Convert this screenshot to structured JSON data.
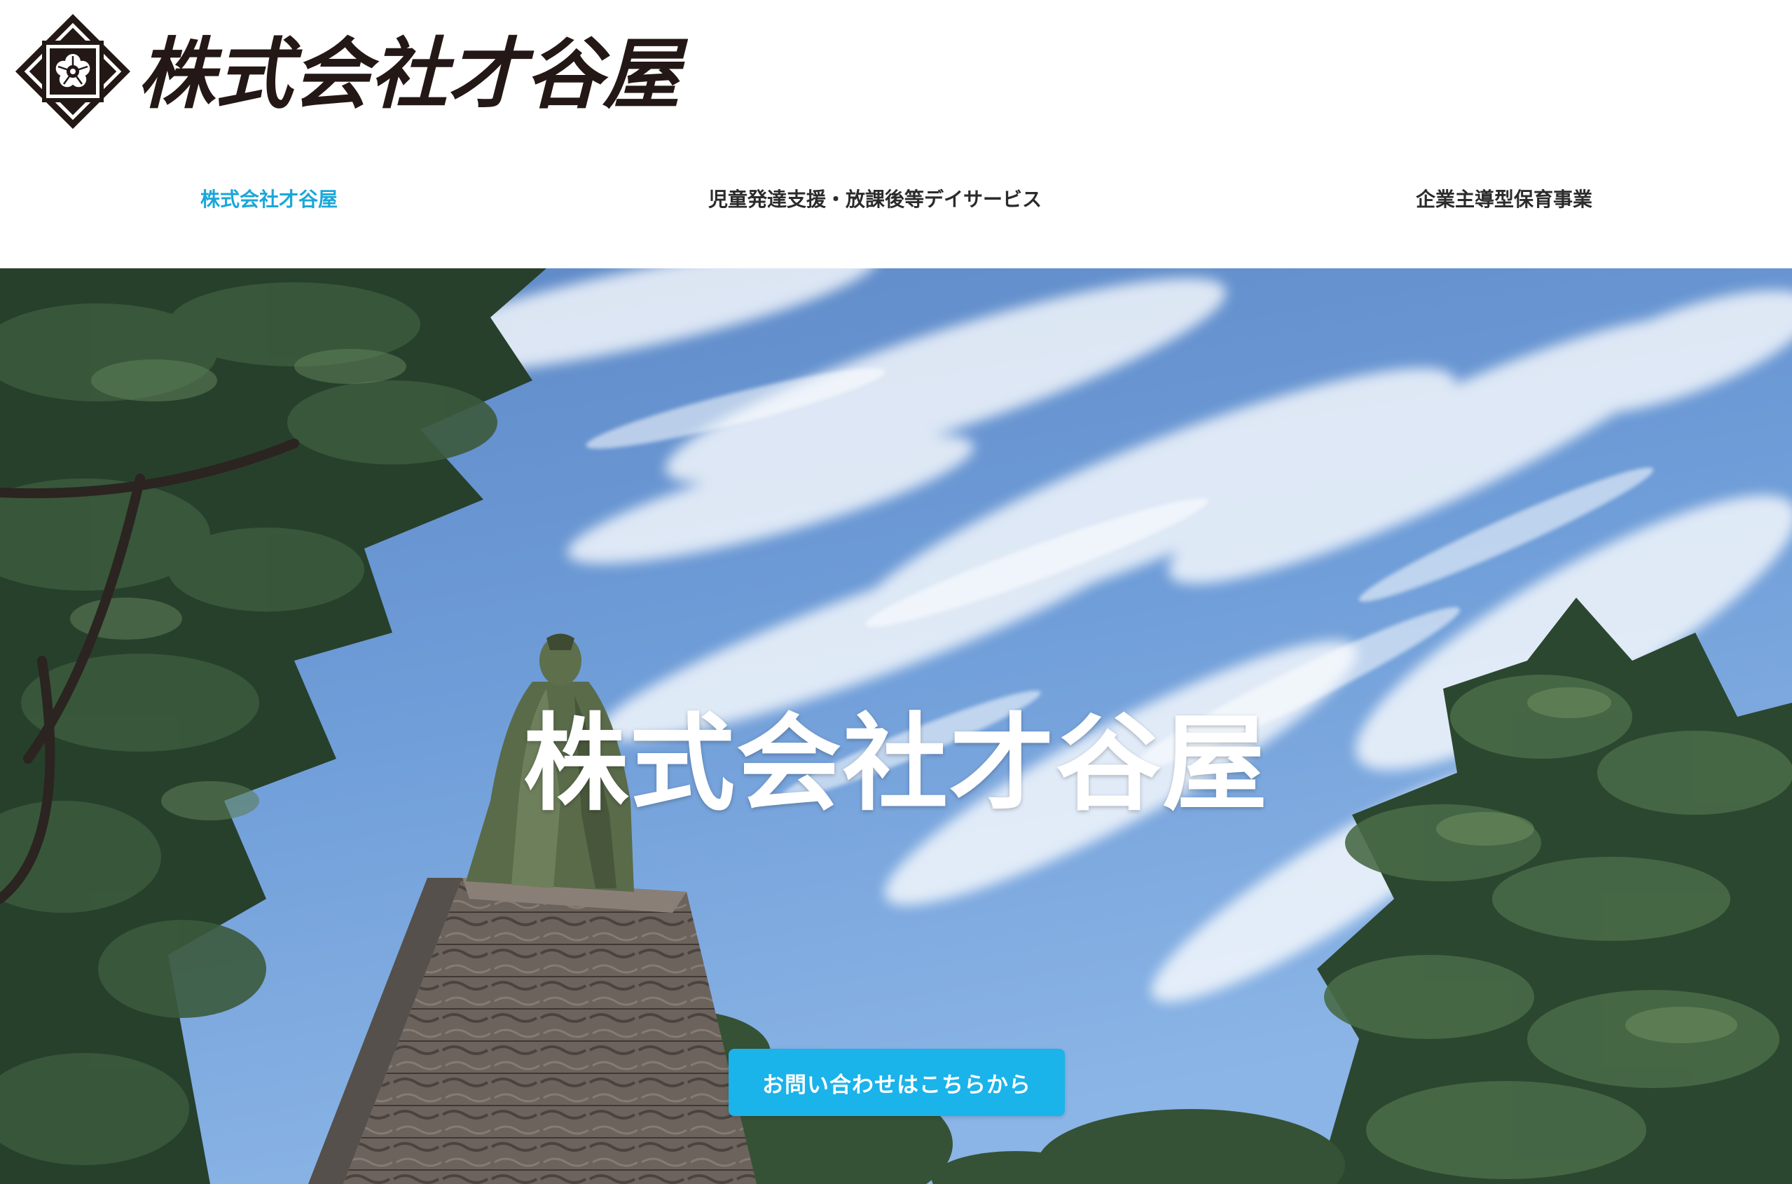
{
  "header": {
    "logo_text": "株式会社才谷屋",
    "nav": [
      {
        "label": "株式会社才谷屋",
        "active": true
      },
      {
        "label": "児童発達支援・放課後等デイサービス",
        "active": false
      },
      {
        "label": "企業主導型保育事業",
        "active": false
      }
    ]
  },
  "hero": {
    "title": "株式会社才谷屋",
    "cta_label": "お問い合わせはこちらから"
  },
  "colors": {
    "accent": "#1aa7d9",
    "button": "#1ab3ea",
    "nav_text": "#2b2b2b",
    "logo_ink": "#231815"
  },
  "icons": {
    "logo_mark": "kikyo-crest-icon"
  }
}
